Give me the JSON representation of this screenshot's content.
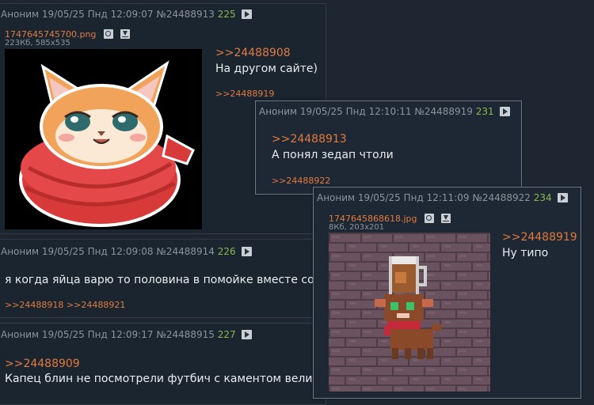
{
  "posts": [
    {
      "header": {
        "name": "Аноним",
        "date": "19/05/25 Пнд 12:09:07",
        "num": "№24488913",
        "count": "225"
      },
      "file": {
        "name": "1747645745700.png",
        "meta": "223Кб, 585x535"
      },
      "reply": ">>24488908",
      "text": "На другом сайте)",
      "backlinks": [
        ">>24488919"
      ]
    },
    {
      "header": {
        "name": "Аноним",
        "date": "19/05/25 Пнд 12:09:08",
        "num": "№24488914",
        "count": "226"
      },
      "text": "я когда яйца варю то половина в помойке вместе со ско",
      "backlinks": [
        ">>24488918",
        ">>24488921"
      ]
    },
    {
      "header": {
        "name": "Аноним",
        "date": "19/05/25 Пнд 12:09:17",
        "num": "№24488915",
        "count": "227"
      },
      "reply": ">>24488909",
      "text": "Капец блин не посмотрели футбич с каментом величай"
    }
  ],
  "popups": [
    {
      "header": {
        "name": "Аноним",
        "date": "19/05/25 Пнд 12:10:11",
        "num": "№24488919",
        "count": "231"
      },
      "reply": ">>24488913",
      "text": "А понял зедап чтоли",
      "backlinks": [
        ">>24488922"
      ]
    },
    {
      "header": {
        "name": "Аноним",
        "date": "19/05/25 Пнд 12:11:09",
        "num": "№24488922",
        "count": "234"
      },
      "file": {
        "name": "1747645868618.jpg",
        "meta": "8Кб, 203x201"
      },
      "reply": ">>24488919",
      "text": "Ну типо"
    }
  ],
  "icons": {
    "reply_button": "play-arrow-icon",
    "search": "magnifier-icon",
    "download": "download-icon"
  },
  "colors": {
    "background": "#1e2731",
    "link": "#e07a3e",
    "counter": "#8bb64c",
    "meta": "#8b949c"
  }
}
